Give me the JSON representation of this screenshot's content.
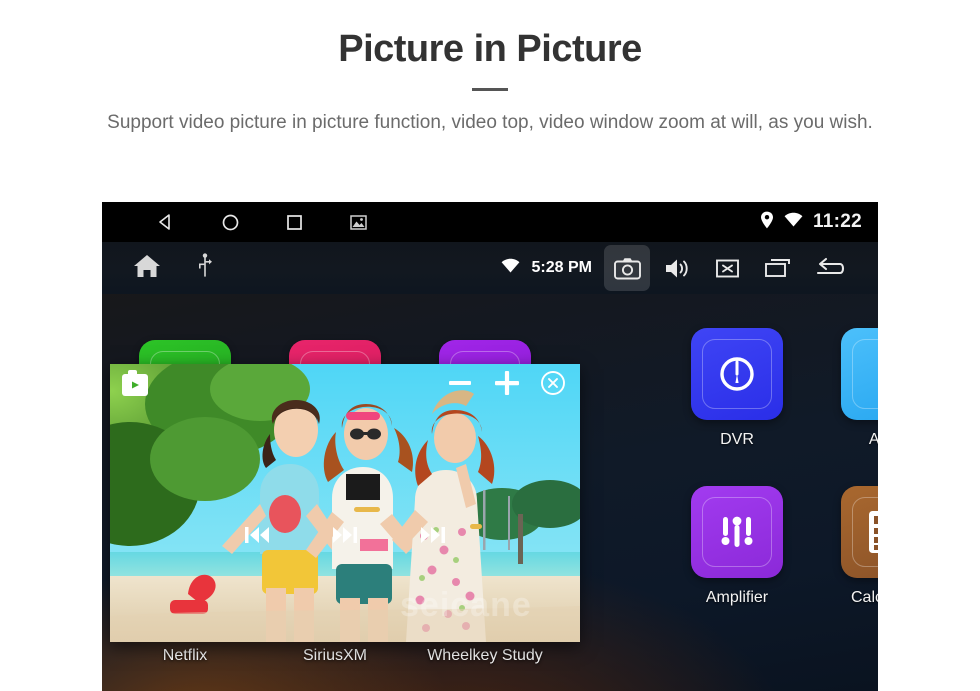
{
  "header": {
    "title": "Picture in Picture",
    "subtitle": "Support video picture in picture function, video top, video window zoom at will, as you wish."
  },
  "device": {
    "status_bar": {
      "nav_buttons": [
        {
          "name": "back-triangle-icon",
          "label": "back"
        },
        {
          "name": "home-circle-icon",
          "label": "home"
        },
        {
          "name": "recents-square-icon",
          "label": "recents"
        },
        {
          "name": "screenshot-icon",
          "label": "screenshot"
        }
      ],
      "location_icon": "location-pin-icon",
      "wifi_icon": "wifi-icon",
      "clock": "11:22"
    },
    "toolbar": {
      "home_icon": "home-icon",
      "usb_icon": "usb-icon",
      "wifi_icon": "wifi-icon",
      "clock": "5:28 PM",
      "camera_label": "camera",
      "volume_label": "volume",
      "mute_label": "mute",
      "recents_label": "recent-apps",
      "back_label": "back"
    },
    "pip": {
      "record_icon": "video-record-icon",
      "zoom_out_label": "zoom out",
      "zoom_in_label": "zoom in",
      "close_label": "close",
      "prev_label": "previous track",
      "play_label": "play pause",
      "next_label": "next track",
      "watermark": "seicane"
    },
    "apps_hidden": [
      {
        "label": "Netflix",
        "color": "#23a020",
        "color2": "#2cc427"
      },
      {
        "label": "SiriusXM",
        "color": "#d61a5c",
        "color2": "#e8256b"
      },
      {
        "label": "Wheelkey Study",
        "color": "#8a1ad4",
        "color2": "#a126e8"
      }
    ],
    "apps": [
      {
        "label": "DVR",
        "icon": "gauge-icon",
        "color": "#2a2ee8",
        "color2": "#3f45f5"
      },
      {
        "label": "AVIN",
        "icon": "av-plug-icon",
        "color": "#27a6f0",
        "color2": "#4cc0fb"
      },
      {
        "label": "Amplifier",
        "icon": "sliders-icon",
        "color": "#8b29d8",
        "color2": "#a23bf0"
      },
      {
        "label": "Calculator",
        "icon": "calculator-icon",
        "color": "#8a5228",
        "color2": "#a9682f"
      }
    ]
  },
  "colors": {
    "title": "#333333",
    "subtitle": "#6b6b6b",
    "screen_bg": "#0d1828",
    "pip_bg": "#6fdcf2"
  }
}
